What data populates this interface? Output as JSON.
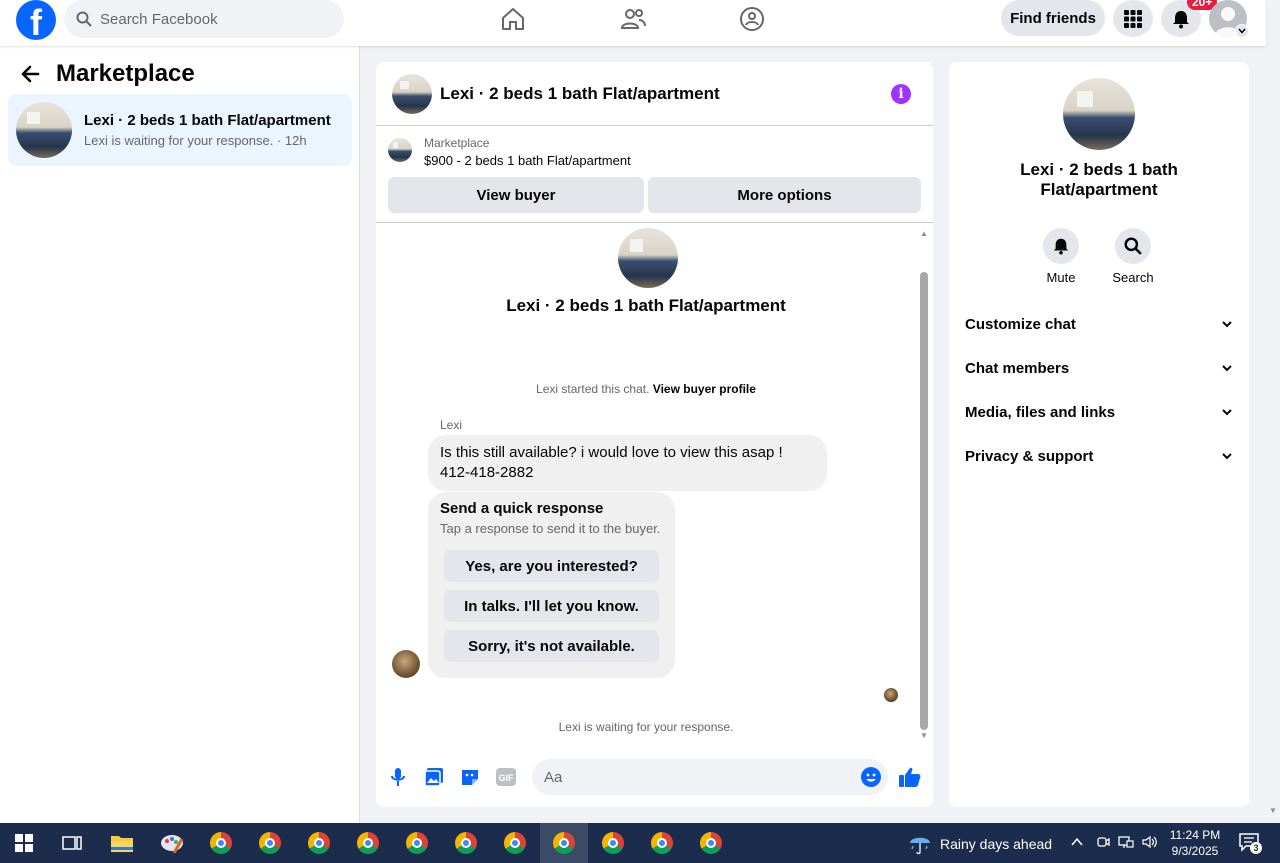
{
  "topbar": {
    "logo": "f",
    "search_placeholder": "Search Facebook",
    "find_friends": "Find friends",
    "notification_badge": "20+"
  },
  "sidebar": {
    "title": "Marketplace",
    "conversation": {
      "name": "Lexi · 2 beds 1 bath Flat/apartment",
      "subtitle": "Lexi is waiting for your response. · 12h"
    }
  },
  "chat": {
    "title": "Lexi · 2 beds 1 bath Flat/apartment",
    "listing_label": "Marketplace",
    "listing_title": "$900 - 2 beds 1 bath Flat/apartment",
    "view_buyer": "View buyer",
    "more_options": "More options",
    "intro_title": "Lexi · 2 beds 1 bath Flat/apartment",
    "started_text": "Lexi started this chat. ",
    "started_link": "View buyer profile",
    "sender_name": "Lexi",
    "message": "Is this still available? i would love to view this asap ! 412-418-2882",
    "quick_title": "Send a quick response",
    "quick_sub": "Tap a response to send it to the buyer.",
    "quick_responses": [
      "Yes, are you interested?",
      "In talks. I'll let you know.",
      "Sorry, it's not available."
    ],
    "waiting": "Lexi is waiting for your response.",
    "composer_placeholder": "Aa"
  },
  "details": {
    "title": "Lexi · 2 beds 1 bath Flat/apartment",
    "actions": [
      "Mute",
      "Search"
    ],
    "menu": [
      "Customize chat",
      "Chat members",
      "Media, files and links",
      "Privacy & support"
    ]
  },
  "taskbar": {
    "weather": "Rainy days ahead",
    "time": "11:24 PM",
    "date": "9/3/2025",
    "notification_count": "3"
  },
  "colors": {
    "brand": "#0866ff",
    "accent_purple": "#a033ff",
    "badge_red": "#e41e3f",
    "taskbar": "#1c2c4c"
  }
}
